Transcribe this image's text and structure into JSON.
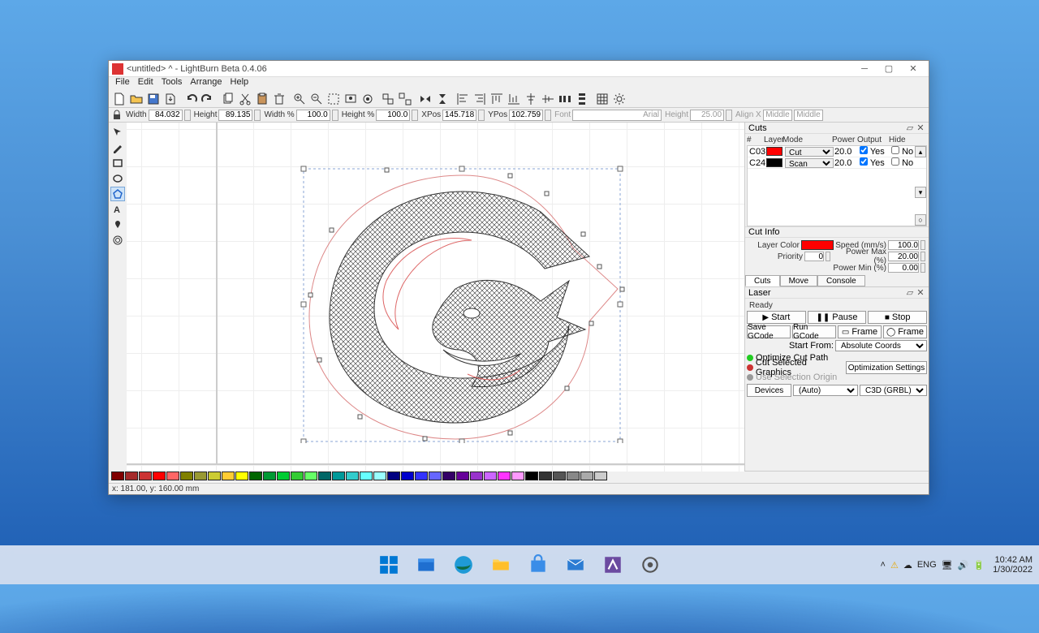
{
  "window": {
    "title": "<untitled> ^ - LightBurn Beta 0.4.06"
  },
  "menu": [
    "File",
    "Edit",
    "Tools",
    "Arrange",
    "Help"
  ],
  "props": {
    "width_lbl": "Width",
    "width": "84.032",
    "height_lbl": "Height",
    "height": "89.135",
    "wpct_lbl": "Width %",
    "wpct": "100.0",
    "hpct_lbl": "Height %",
    "hpct": "100.0",
    "xpos_lbl": "XPos",
    "xpos": "145.718",
    "ypos_lbl": "YPos",
    "ypos": "102.759",
    "font_lbl": "Font",
    "font": "Arial",
    "fheight_lbl": "Height",
    "fheight": "25.00",
    "alignx_lbl": "Align X",
    "alignx": "Middle",
    "aligny": "Middle"
  },
  "cuts_panel": {
    "title": "Cuts",
    "headers": [
      "#",
      "Layer",
      "Mode",
      "Power",
      "Output",
      "Hide"
    ],
    "rows": [
      {
        "id": "C03",
        "color": "#ff0000",
        "mode": "Cut",
        "power": "20.0",
        "output": true,
        "out_lbl": "Yes",
        "hide": false,
        "hide_lbl": "No"
      },
      {
        "id": "C24",
        "color": "#000000",
        "mode": "Scan",
        "power": "20.0",
        "output": true,
        "out_lbl": "Yes",
        "hide": false,
        "hide_lbl": "No"
      }
    ]
  },
  "cutinfo": {
    "title": "Cut Info",
    "layer_color_lbl": "Layer Color",
    "color": "#ff0000",
    "speed_lbl": "Speed  (mm/s)",
    "speed": "100.0",
    "priority_lbl": "Priority",
    "priority": "0",
    "pmax_lbl": "Power Max (%)",
    "pmax": "20.00",
    "pmin_lbl": "Power Min (%)",
    "pmin": "0.00"
  },
  "bottom_tabs": [
    "Cuts",
    "Move",
    "Console"
  ],
  "laser": {
    "title": "Laser",
    "status": "Ready",
    "start": "Start",
    "pause": "Pause",
    "stop": "Stop",
    "save_gcode": "Save GCode",
    "run_gcode": "Run GCode",
    "frame": "Frame",
    "oframe": "Frame",
    "start_from_lbl": "Start From:",
    "start_from": "Absolute Coords",
    "opt_path": "Optimize Cut Path",
    "cut_sel": "Cut Selected Graphics",
    "use_sel": "Use Selection Origin",
    "opt_settings": "Optimization Settings",
    "devices": "Devices",
    "port": "(Auto)",
    "device": "C3D (GRBL)"
  },
  "palette": [
    "#800000",
    "#a52a2a",
    "#cc3333",
    "#ff0000",
    "#ff6666",
    "#808000",
    "#999933",
    "#cccc33",
    "#ffcc33",
    "#ffff00",
    "#006600",
    "#009933",
    "#00cc33",
    "#33cc33",
    "#66ff66",
    "#006666",
    "#009999",
    "#33cccc",
    "#66ffff",
    "#99ffff",
    "#000080",
    "#0000cc",
    "#3333ff",
    "#6666ff",
    "#330066",
    "#660099",
    "#9933cc",
    "#cc66ff",
    "#ff33ff",
    "#ff99ff",
    "#000000",
    "#333333",
    "#555555",
    "#888888",
    "#aaaaaa",
    "#cccccc"
  ],
  "status": "x: 181.00, y: 160.00 mm",
  "taskbar": {
    "lang": "ENG",
    "time": "10:42 AM",
    "date": "1/30/2022"
  }
}
